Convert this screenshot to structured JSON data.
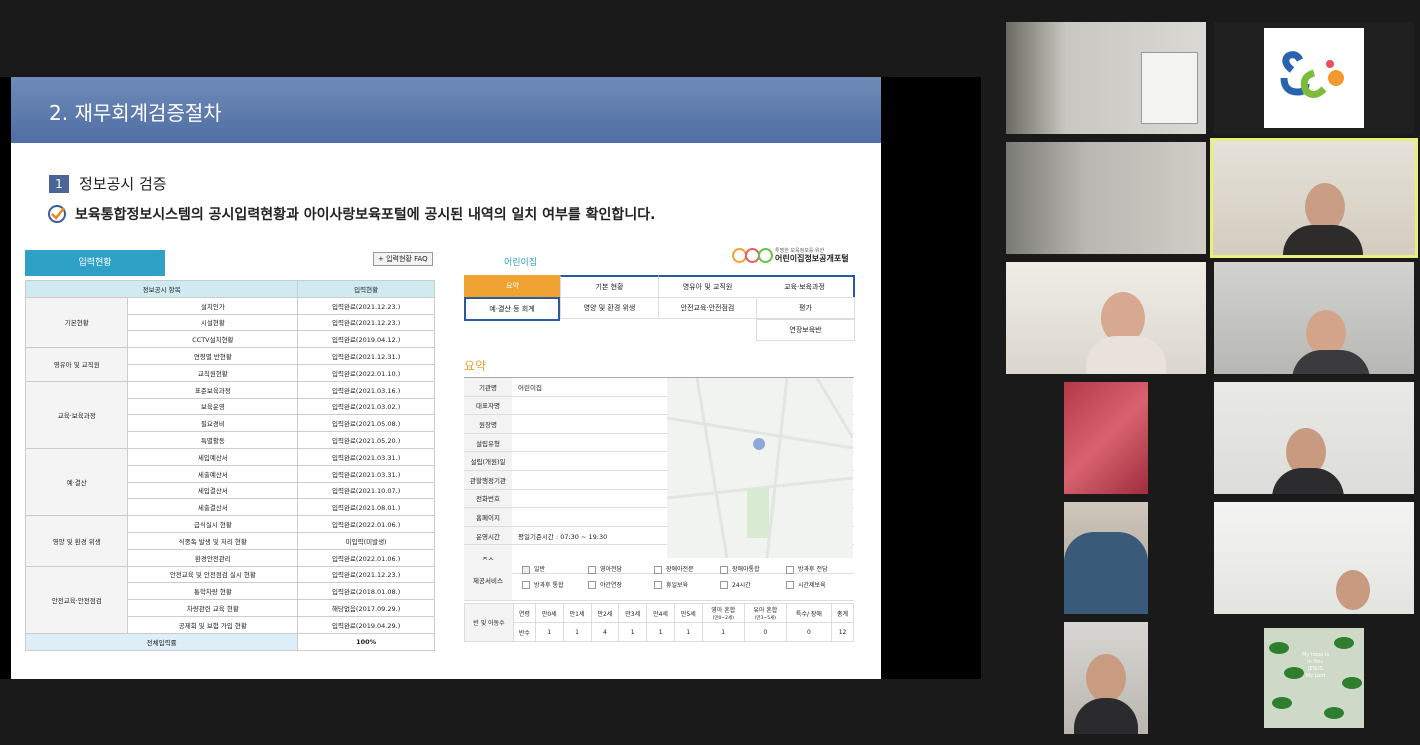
{
  "slide": {
    "title": "2. 재무회계검증절차",
    "section_number": "1",
    "section_title": "정보공시 검증",
    "description": "보육통합정보시스템의 공시입력현황과 아이사랑보육포털에 공시된 내역의 일치 여부를 확인합니다."
  },
  "left_table": {
    "tab_label": "입력현황",
    "faq_button": "+ 입력현황 FAQ",
    "headers": [
      "정보공시 항목",
      "입력현황"
    ],
    "rows": [
      {
        "cat": "기본현황",
        "item": "설치인가",
        "status": "입력완료(2021.12.23.)"
      },
      {
        "cat": "",
        "item": "시설현황",
        "status": "입력완료(2021.12.23.)"
      },
      {
        "cat": "",
        "item": "CCTV설치현황",
        "status": "입력완료(2019.04.12.)"
      },
      {
        "cat": "영유아 및 교직원",
        "item": "연령별 반현황",
        "status": "입력완료(2021.12.31.)"
      },
      {
        "cat": "",
        "item": "교직원현황",
        "status": "입력완료(2022.01.10.)"
      },
      {
        "cat": "교육·보육과정",
        "item": "표준보육과정",
        "status": "입력완료(2021.03.16.)"
      },
      {
        "cat": "",
        "item": "보육운영",
        "status": "입력완료(2021.03.02.)"
      },
      {
        "cat": "",
        "item": "필요경비",
        "status": "입력완료(2021.05.08.)"
      },
      {
        "cat": "",
        "item": "특별활동",
        "status": "입력완료(2021.05.20.)"
      },
      {
        "cat": "예·결산",
        "item": "세입예산서",
        "status": "입력완료(2021.03.31.)"
      },
      {
        "cat": "",
        "item": "세출예산서",
        "status": "입력완료(2021.03.31.)"
      },
      {
        "cat": "",
        "item": "세입결산서",
        "status": "입력완료(2021.10.07.)"
      },
      {
        "cat": "",
        "item": "세출결산서",
        "status": "입력완료(2021.08.01.)"
      },
      {
        "cat": "영양 및 환경 위생",
        "item": "급식실시 현황",
        "status": "입력완료(2022.01.06.)"
      },
      {
        "cat": "",
        "item": "식중독 발생 및 처리 현황",
        "status": "미입력(미발생)"
      },
      {
        "cat": "",
        "item": "환경안전관리",
        "status": "입력완료(2022.01.06.)"
      },
      {
        "cat": "안전교육·안전점검",
        "item": "안전교육 및 안전점검 실시 현황",
        "status": "입력완료(2021.12.23.)"
      },
      {
        "cat": "",
        "item": "통학차량 현황",
        "status": "입력완료(2018.01.08.)"
      },
      {
        "cat": "",
        "item": "차량관련 교육 현황",
        "status": "해당없음(2017.09.29.)"
      },
      {
        "cat": "",
        "item": "공제회 및 보험 가입 현황",
        "status": "입력완료(2019.04.29.)"
      }
    ],
    "total_label": "전체입력률",
    "total_value": "100%"
  },
  "portal": {
    "name": "어린이집",
    "logo_sub": "투명한 보육정보를 위한",
    "logo_title": "어린이집정보공개포털",
    "tabs": [
      "요약",
      "기본 현황",
      "영유아 및 교직원",
      "교육·보육과정",
      "예·결산 등 회계",
      "영양 및 환경 위생",
      "안전교육·안전점검",
      "평가",
      "연장보육반"
    ],
    "summary_title": "요약",
    "info_rows": [
      {
        "k": "기관명",
        "v": "어린이집"
      },
      {
        "k": "대표자명",
        "v": ""
      },
      {
        "k": "원장명",
        "v": ""
      },
      {
        "k": "설립유형",
        "v": ""
      },
      {
        "k": "설립(개원)일",
        "v": ""
      },
      {
        "k": "관할행정기관",
        "v": ""
      },
      {
        "k": "전화번호",
        "v": ""
      },
      {
        "k": "홈페이지",
        "v": ""
      },
      {
        "k": "운영시간",
        "v": "평일기준시간 : 07:30 ~ 19:30"
      },
      {
        "k": "주소",
        "v": ""
      }
    ],
    "service_label": "제공서비스",
    "services": [
      "일반",
      "영아전담",
      "장애아전문",
      "장애아통합",
      "방과후 전담",
      "방과후 통합",
      "야간연장",
      "휴일보육",
      "24시간",
      "시간제보육"
    ],
    "ages_label": "반 및 아동수",
    "age_headers": [
      "연령",
      "만0세",
      "만1세",
      "만2세",
      "만3세",
      "만4세",
      "만5세",
      "영아 혼합",
      "유아 혼합",
      "특수/ 장애",
      "총계"
    ],
    "age_sub": [
      "(만0~2세)",
      "(만3~5세)"
    ],
    "age_row_label": "반수",
    "age_values": [
      "1",
      "1",
      "4",
      "1",
      "1",
      "1",
      "1",
      "0",
      "0",
      "12"
    ]
  },
  "tiles": [
    {
      "id": "tile-1"
    },
    {
      "id": "tile-2"
    },
    {
      "id": "tile-3"
    },
    {
      "id": "tile-4"
    },
    {
      "id": "tile-5"
    },
    {
      "id": "tile-6"
    },
    {
      "id": "tile-7"
    },
    {
      "id": "tile-8"
    },
    {
      "id": "tile-9"
    },
    {
      "id": "tile-10"
    },
    {
      "id": "tile-11"
    },
    {
      "id": "tile-12"
    }
  ],
  "tile_texts": {
    "poster_line1": "My hope is",
    "poster_line2": "in You,",
    "poster_line3": "JESUS",
    "poster_line4": "My Lord"
  }
}
